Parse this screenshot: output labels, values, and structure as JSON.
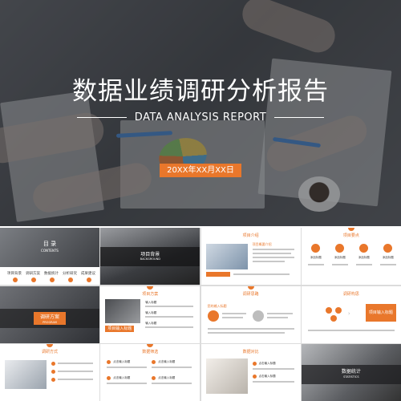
{
  "hero": {
    "title": "数据业绩调研分析报告",
    "subtitle": "DATA ANALYSIS REPORT",
    "date": "20XX年XX月XX日"
  },
  "colors": {
    "accent": "#e9772b",
    "overlay": "#3f4247",
    "text_light": "#ffffff"
  },
  "slides": [
    {
      "kind": "contents",
      "title": "目 录",
      "title_en": "CONTENTS",
      "items": [
        "项目背景",
        "调研方案",
        "数据统计",
        "分析研究",
        "成果建议"
      ]
    },
    {
      "kind": "section",
      "title": "项目背景",
      "title_en": "BACKGROUND"
    },
    {
      "kind": "content",
      "header": "项目介绍",
      "tag": "项目概要介绍"
    },
    {
      "kind": "content",
      "header": "项目要点",
      "items": [
        "添加标题",
        "添加标题",
        "添加标题",
        "添加标题"
      ]
    },
    {
      "kind": "section",
      "title": "调研方案",
      "title_en": "PROGRAM"
    },
    {
      "kind": "content",
      "header": "项目方案",
      "tag": "项目输入标题",
      "bullets": [
        "输入标题",
        "输入标题",
        "输入标题"
      ]
    },
    {
      "kind": "content",
      "header": "调研思路",
      "tag": "您的输入标题"
    },
    {
      "kind": "content",
      "header": "调研构思",
      "tag": "项目输入标题"
    },
    {
      "kind": "content",
      "header": "调研方式"
    },
    {
      "kind": "content",
      "header": "数据筛选",
      "bullets": [
        "点击输入标题",
        "点击输入标题",
        "点击输入标题",
        "点击输入标题"
      ]
    },
    {
      "kind": "content",
      "header": "数据对比",
      "bullets": [
        "点击输入标题",
        "点击输入标题"
      ]
    },
    {
      "kind": "section",
      "title": "数据统计",
      "title_en": "STATISTICS"
    }
  ]
}
